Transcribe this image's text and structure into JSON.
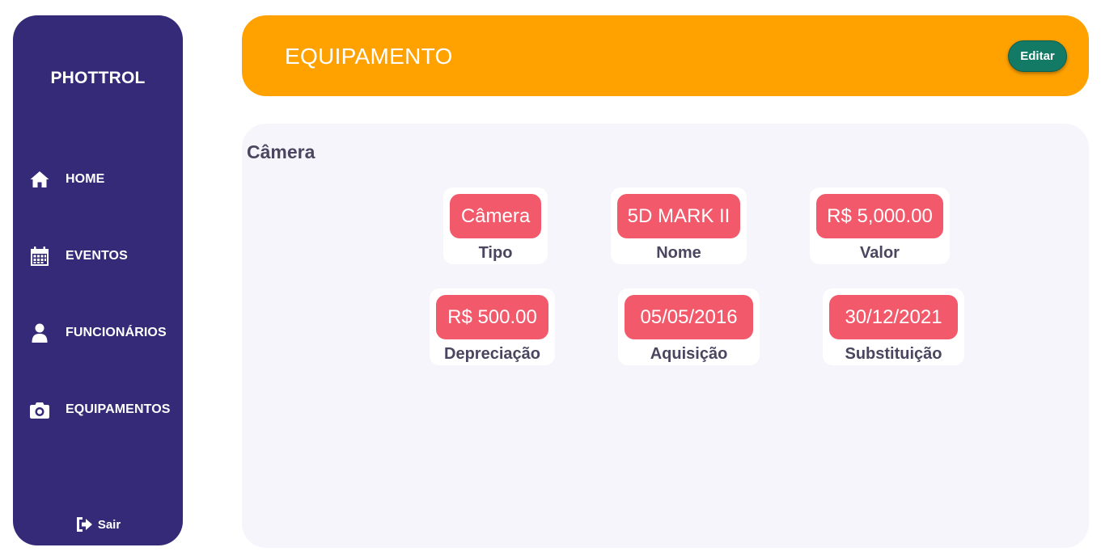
{
  "sidebar": {
    "brand": "PHOTTROL",
    "items": [
      {
        "label": "HOME",
        "icon": "home-icon"
      },
      {
        "label": "EVENTOS",
        "icon": "calendar-icon"
      },
      {
        "label": "FUNCIONÁRIOS",
        "icon": "user-icon"
      },
      {
        "label": "EQUIPAMENTOS",
        "icon": "camera-icon"
      }
    ],
    "logout": {
      "label": "Sair",
      "icon": "sign-out-icon"
    }
  },
  "header": {
    "title": "EQUIPAMENTO",
    "edit_label": "Editar"
  },
  "content": {
    "title": "Câmera",
    "fields": [
      {
        "value": "Câmera",
        "label": "Tipo"
      },
      {
        "value": "5D MARK II",
        "label": "Nome"
      },
      {
        "value": "R$ 5,000.00",
        "label": "Valor"
      },
      {
        "value": "R$ 500.00",
        "label": "Depreciação"
      },
      {
        "value": "05/05/2016",
        "label": "Aquisição"
      },
      {
        "value": "30/12/2021",
        "label": "Substituição"
      }
    ]
  },
  "colors": {
    "sidebar": "#342a78",
    "header": "#ffa200",
    "edit_button": "#137a66",
    "value_badge": "#f25a6b",
    "content_bg": "#f6f5fb",
    "text_dark": "#4b4560"
  }
}
